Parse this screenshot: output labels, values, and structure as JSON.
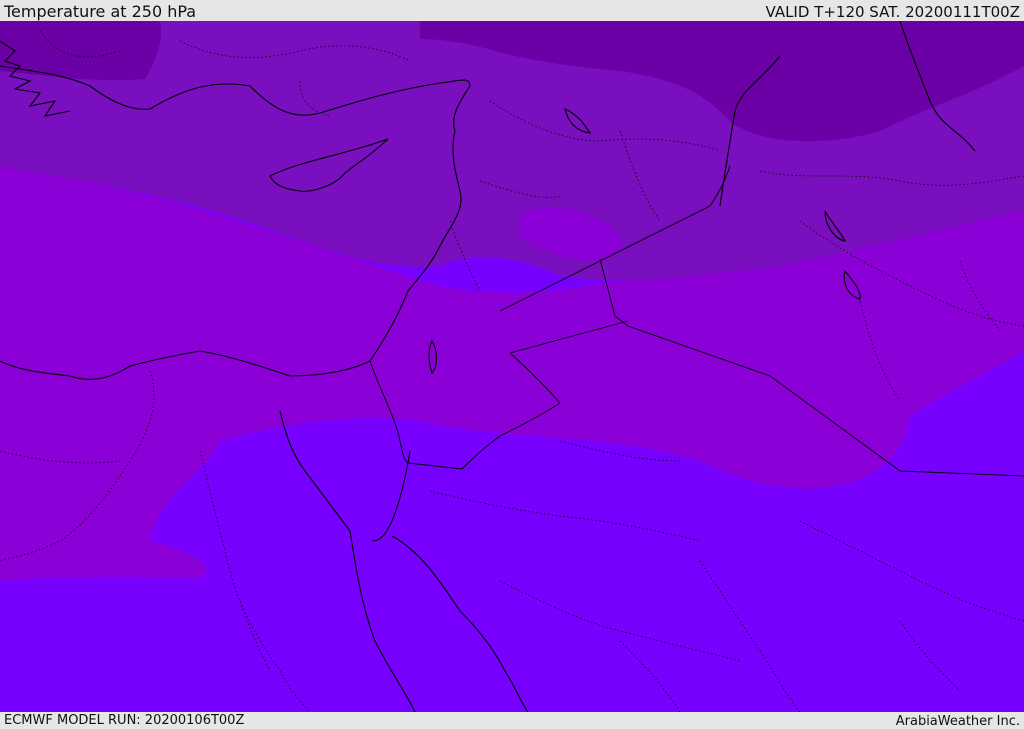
{
  "header": {
    "title": "Temperature at 250 hPa",
    "valid_time": "VALID T+120 SAT. 20200111T00Z"
  },
  "footer": {
    "model_run": "ECMWF MODEL RUN: 20200106T00Z",
    "brand": "ArabiaWeather Inc."
  },
  "map": {
    "colors": {
      "coldest": "#6a00a6",
      "cold": "#7a0fbf",
      "mid": "#8a00d6",
      "warm": "#7800ff",
      "border": "#000000"
    }
  }
}
